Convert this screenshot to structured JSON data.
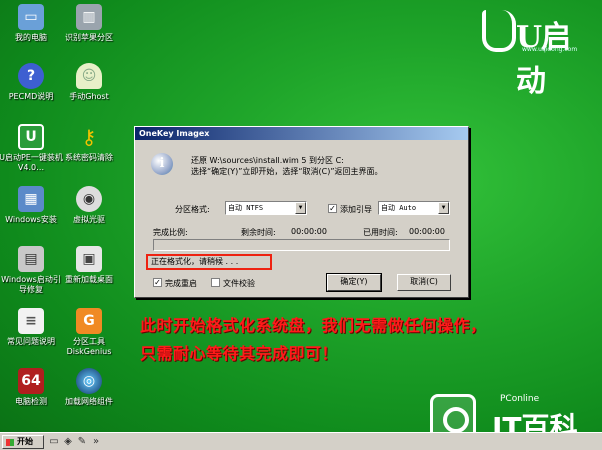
{
  "desktop": {
    "icons": [
      {
        "label": "我的电脑",
        "icon": "computer-icon"
      },
      {
        "label": "识别苹果分区",
        "icon": "disk-icon"
      },
      {
        "label": "PECMD说明",
        "icon": "help-icon"
      },
      {
        "label": "手动Ghost",
        "icon": "ghost-icon"
      },
      {
        "label": "U启动PE一键装机 V4.0…",
        "icon": "installer-icon"
      },
      {
        "label": "系统密码清除",
        "icon": "key-icon"
      },
      {
        "label": "Windows安装",
        "icon": "windows-setup-icon"
      },
      {
        "label": "虚拟光驱",
        "icon": "virtual-drive-icon"
      },
      {
        "label": "Windows启动引导修复",
        "icon": "boot-repair-icon"
      },
      {
        "label": "重新加载桌面",
        "icon": "reload-desktop-icon"
      },
      {
        "label": "常见问题说明",
        "icon": "document-icon"
      },
      {
        "label": "分区工具DiskGenius",
        "icon": "diskgenius-icon"
      },
      {
        "label": "电脑检测",
        "icon": "detect-icon"
      },
      {
        "label": "加载网络组件",
        "icon": "network-icon"
      }
    ]
  },
  "logo": {
    "brand": "U启动",
    "url": "www.uqidong.com"
  },
  "dialog": {
    "title": "OneKey Imagex",
    "message_line1": "还原 W:\\sources\\install.wim 5 到分区 C:",
    "message_line2": "选择“确定(Y)”立即开始，选择“取消(C)”返回主界面。",
    "format_label": "分区格式:",
    "format_value": "自动 NTFS",
    "boot_checkbox_label": "添加引导",
    "boot_value": "自动 Auto",
    "progress_label": "完成比例:",
    "remaining_label": "剩余时间:",
    "remaining_value": "00:00:00",
    "elapsed_label": "已用时间:",
    "elapsed_value": "00:00:00",
    "progress_fraction": 0,
    "status_text": "正在格式化，请稍候 . . .",
    "reboot_checkbox_label": "完成重启",
    "verify_checkbox_label": "文件校验",
    "ok_label": "确定(Y)",
    "cancel_label": "取消(C)"
  },
  "annotation": {
    "line1": "此时开始格式化系统盘，我们无需做任何操作，",
    "line2": "只需耐心等待其完成即可！"
  },
  "watermark": {
    "small": "PConline",
    "big": "IT百科"
  },
  "taskbar": {
    "start_label": "开始"
  },
  "colors": {
    "desktop": "#1fa52a",
    "annotation": "#ff1a1a",
    "highlight_box": "#e21111",
    "titlebar": "#0a246a"
  }
}
